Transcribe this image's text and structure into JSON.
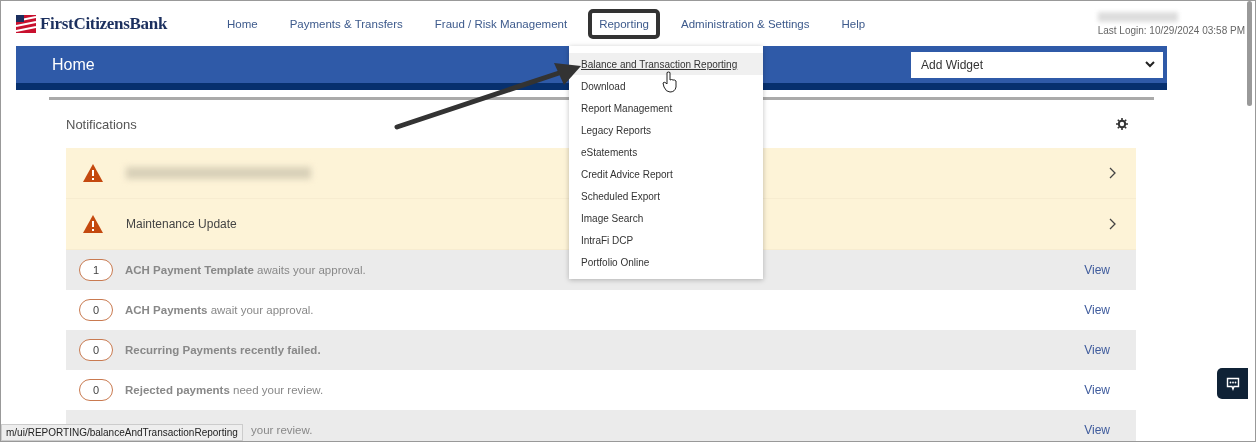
{
  "logo": {
    "text": "FirstCitizensBank"
  },
  "nav": [
    {
      "label": "Home",
      "selected": false
    },
    {
      "label": "Payments & Transfers",
      "selected": false
    },
    {
      "label": "Fraud / Risk Management",
      "selected": false
    },
    {
      "label": "Reporting",
      "selected": true
    },
    {
      "label": "Administration & Settings",
      "selected": false
    },
    {
      "label": "Help",
      "selected": false
    }
  ],
  "last_login": "Last Login: 10/29/2024 03:58 PM",
  "page_title": "Home",
  "widget_select": {
    "value": "Add Widget"
  },
  "dropdown": {
    "items": [
      {
        "label": "Balance and Transaction Reporting",
        "selected": true
      },
      {
        "label": "Download",
        "selected": false
      },
      {
        "label": "Report Management",
        "selected": false
      },
      {
        "label": "Legacy Reports",
        "selected": false
      },
      {
        "label": "eStatements",
        "selected": false
      },
      {
        "label": "Credit Advice Report",
        "selected": false
      },
      {
        "label": "Scheduled Export",
        "selected": false
      },
      {
        "label": "Image Search",
        "selected": false
      },
      {
        "label": "IntraFi DCP",
        "selected": false
      },
      {
        "label": "Portfolio Online",
        "selected": false
      }
    ]
  },
  "notifications": {
    "title": "Notifications",
    "alerts": [
      {
        "kind": "blurred"
      },
      {
        "kind": "text",
        "label": "Maintenance Update"
      }
    ],
    "rows": [
      {
        "count": "1",
        "text": "**ACH Payment Template** awaits your approval.",
        "action": "View"
      },
      {
        "count": "0",
        "text": "**ACH Payments** await your approval.",
        "action": "View"
      },
      {
        "count": "0",
        "text": "**Recurring Payments recently failed.**",
        "action": "View"
      },
      {
        "count": "0",
        "text": "**Rejected payments** need your review.",
        "action": "View"
      },
      {
        "text": "your review.",
        "action": "View"
      }
    ]
  },
  "status_url": "m/ui/REPORTING/balanceAndTransactionReporting"
}
